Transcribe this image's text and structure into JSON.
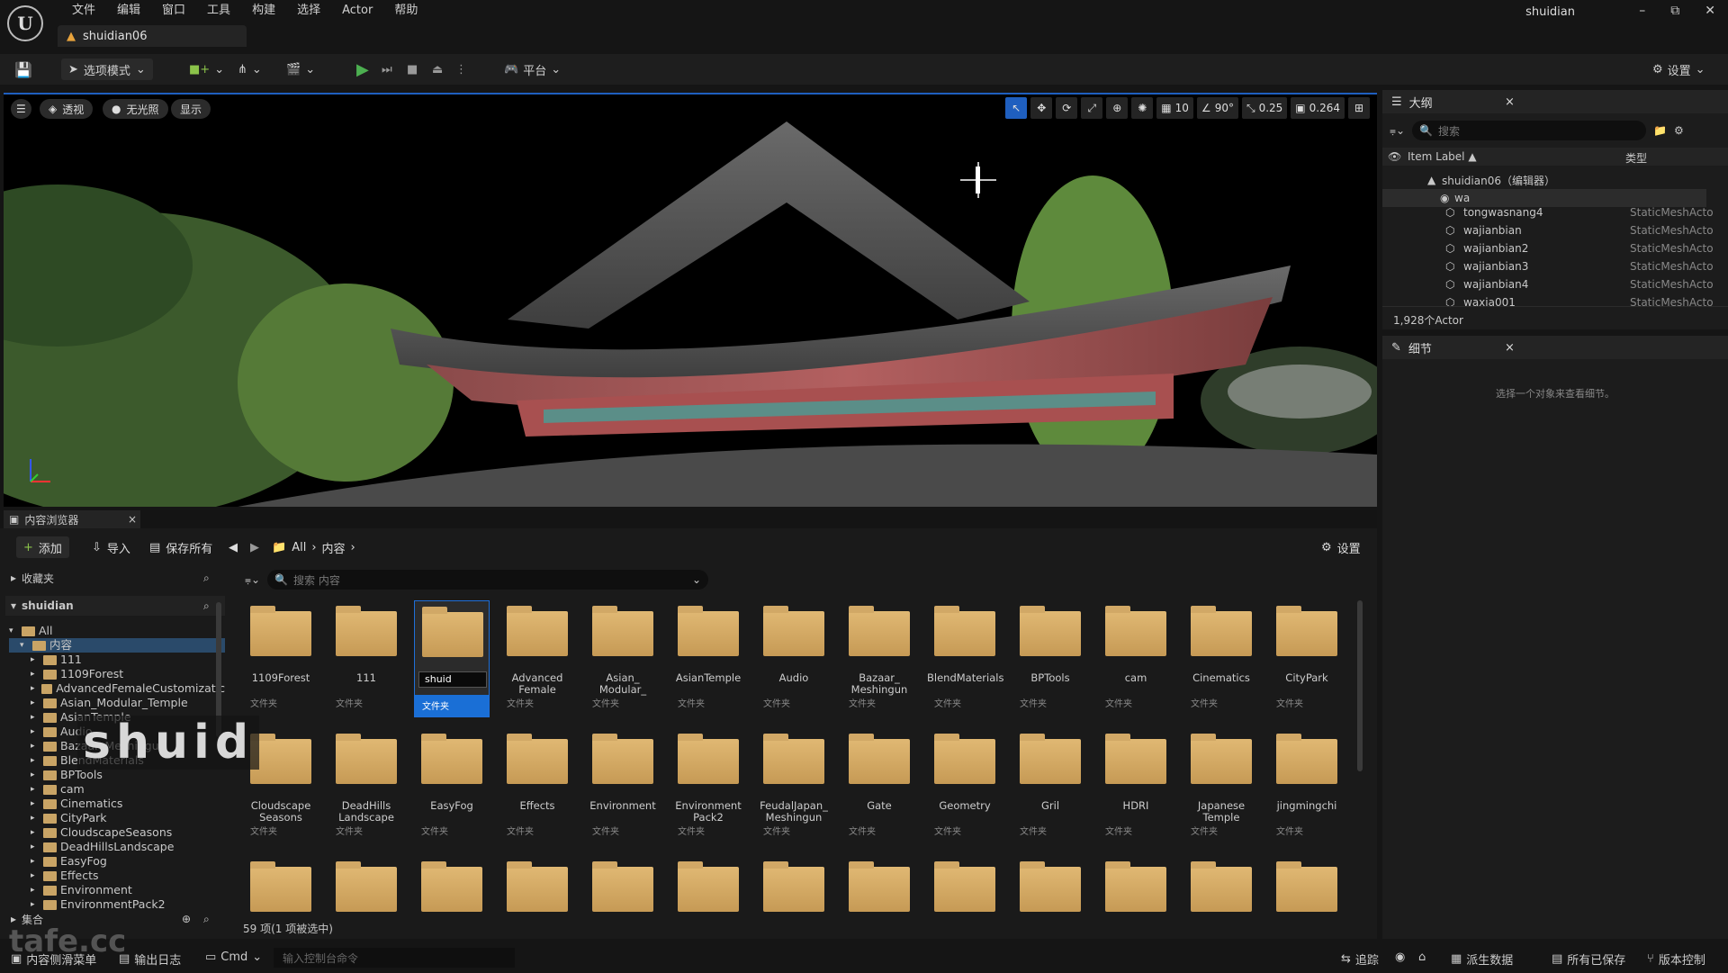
{
  "app": {
    "menu": [
      "文件",
      "编辑",
      "窗口",
      "工具",
      "构建",
      "选择",
      "Actor",
      "帮助"
    ],
    "doc_tab": "shuidian06",
    "project_name": "shuidian",
    "window_controls": [
      "–",
      "⧉",
      "✕"
    ]
  },
  "toolbar": {
    "mode_label": "选项模式",
    "platform_label": "平台",
    "settings_label": "设置"
  },
  "viewport": {
    "perspective": "透视",
    "lighting": "无光照",
    "show": "显示",
    "grid_snap": "10",
    "angle_snap": "90°",
    "scale_snap": "0.25",
    "camera_speed": "0.264"
  },
  "outliner": {
    "tab": "大纲",
    "search_placeholder": "搜索",
    "col_label": "Item Label ▲",
    "col_type": "类型",
    "root": "shuidian06（编辑器）",
    "folder": "wa",
    "rows": [
      {
        "name": "tongwasnang4",
        "type": "StaticMeshActo"
      },
      {
        "name": "wajianbian",
        "type": "StaticMeshActo"
      },
      {
        "name": "wajianbian2",
        "type": "StaticMeshActo"
      },
      {
        "name": "wajianbian3",
        "type": "StaticMeshActo"
      },
      {
        "name": "wajianbian4",
        "type": "StaticMeshActo"
      },
      {
        "name": "waxia001",
        "type": "StaticMeshActo"
      }
    ],
    "count": "1,928个Actor"
  },
  "details": {
    "tab": "细节",
    "empty_msg": "选择一个对象来查看细节。"
  },
  "content_browser": {
    "tab": "内容浏览器",
    "add": "添加",
    "import": "导入",
    "save_all": "保存所有",
    "crumb_all": "All",
    "crumb_content": "内容",
    "settings": "设置",
    "favorites": "收藏夹",
    "project": "shuidian",
    "search_placeholder": "搜索 内容",
    "collections": "集合",
    "item_count": "59 项(1 项被选中)",
    "tree": [
      "All",
      "内容",
      "111",
      "1109Forest",
      "AdvancedFemaleCustomizatic",
      "Asian_Modular_Temple",
      "AsianTemple",
      "Audio",
      "Bazaar_Meshingun",
      "BlendMaterials",
      "BPTools",
      "cam",
      "Cinematics",
      "CityPark",
      "CloudscapeSeasons",
      "DeadHillsLandscape",
      "EasyFog",
      "Effects",
      "Environment",
      "EnvironmentPack2"
    ],
    "folder_type": "文件夹",
    "rename_value": "shuid",
    "row1": [
      "1109Forest",
      "111",
      "",
      "Advanced Female",
      "Asian_ Modular_",
      "AsianTemple",
      "Audio",
      "Bazaar_ Meshingun",
      "BlendMaterials",
      "BPTools",
      "cam",
      "Cinematics",
      "CityPark"
    ],
    "row2": [
      "Cloudscape Seasons",
      "DeadHills Landscape",
      "EasyFog",
      "Effects",
      "Environment",
      "Environment Pack2",
      "FeudalJapan_ Meshingun",
      "Gate",
      "Geometry",
      "Gril",
      "HDRI",
      "Japanese Temple",
      "jingmingchi"
    ]
  },
  "overlay": {
    "typed": "shuid",
    "watermark": "tafe.cc"
  },
  "statusbar": {
    "drawer": "内容侧滑菜单",
    "output": "输出日志",
    "cmd": "Cmd",
    "console_placeholder": "输入控制台命令",
    "trace": "追踪",
    "derived": "派生数据",
    "saved": "所有已保存",
    "source_control": "版本控制"
  }
}
